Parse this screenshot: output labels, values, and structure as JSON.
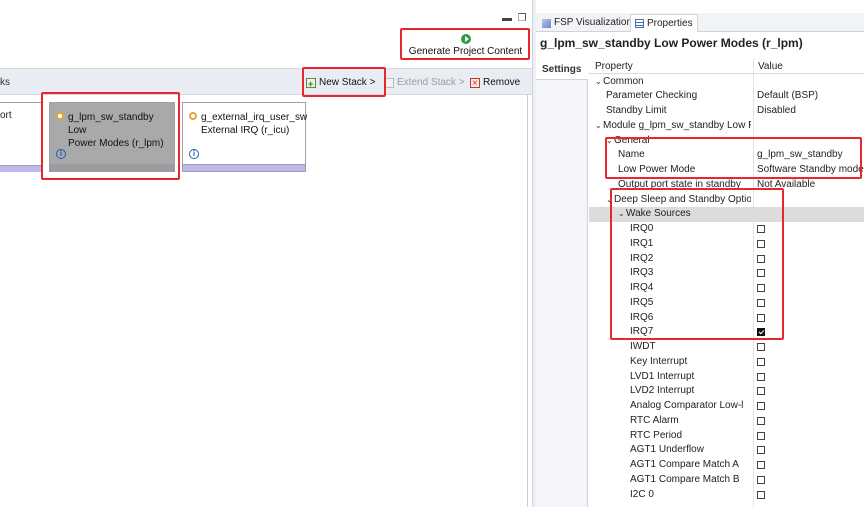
{
  "editor": {
    "generate_label": "Generate Project Content",
    "stacks_title": "ks",
    "toolbar": {
      "new_stack": "New Stack >",
      "extend_stack": "Extend Stack >",
      "remove": "Remove"
    },
    "partial_stack_text": "ort",
    "stacks": [
      {
        "line1": "g_lpm_sw_standby Low",
        "line2": "Power Modes (r_lpm)",
        "selected": true
      },
      {
        "line1": "g_external_irq_user_sw",
        "line2": "External IRQ (r_icu)",
        "selected": false
      }
    ],
    "window_controls": {
      "minimize": "▬",
      "maximize": "❐"
    }
  },
  "properties": {
    "tabs": [
      {
        "label": "FSP Visualization",
        "icon": "fsp-visualization-icon"
      },
      {
        "label": "Properties",
        "icon": "properties-icon",
        "active": true
      }
    ],
    "title": "g_lpm_sw_standby Low Power Modes (r_lpm)",
    "settings_tab": "Settings",
    "columns": {
      "property": "Property",
      "value": "Value"
    },
    "rows": [
      {
        "label": "Common",
        "indent": 0,
        "expander": "down"
      },
      {
        "label": "Parameter Checking",
        "value": "Default (BSP)",
        "indent": 1
      },
      {
        "label": "Standby Limit",
        "value": "Disabled",
        "indent": 1
      },
      {
        "label": "Module g_lpm_sw_standby Low Pc",
        "indent": 0,
        "expander": "down"
      },
      {
        "label": "General",
        "indent": 1,
        "expander": "down"
      },
      {
        "label": "Name",
        "value": "g_lpm_sw_standby",
        "indent": 2
      },
      {
        "label": "Low Power Mode",
        "value": "Software Standby mode",
        "indent": 2
      },
      {
        "label": "Output port state in standby",
        "value": "Not Available",
        "indent": 2
      },
      {
        "label": "Deep Sleep and Standby Optio",
        "indent": 1,
        "expander": "down"
      },
      {
        "label": "Wake Sources",
        "indent": 2,
        "expander": "down",
        "selected": true
      },
      {
        "label": "IRQ0",
        "checkbox": false,
        "indent": 3
      },
      {
        "label": "IRQ1",
        "checkbox": false,
        "indent": 3
      },
      {
        "label": "IRQ2",
        "checkbox": false,
        "indent": 3
      },
      {
        "label": "IRQ3",
        "checkbox": false,
        "indent": 3
      },
      {
        "label": "IRQ4",
        "checkbox": false,
        "indent": 3
      },
      {
        "label": "IRQ5",
        "checkbox": false,
        "indent": 3
      },
      {
        "label": "IRQ6",
        "checkbox": false,
        "indent": 3
      },
      {
        "label": "IRQ7",
        "checkbox": true,
        "indent": 3
      },
      {
        "label": "IWDT",
        "checkbox": false,
        "indent": 3
      },
      {
        "label": "Key Interrupt",
        "checkbox": false,
        "indent": 3
      },
      {
        "label": "LVD1 Interrupt",
        "checkbox": false,
        "indent": 3
      },
      {
        "label": "LVD2 Interrupt",
        "checkbox": false,
        "indent": 3
      },
      {
        "label": "Analog Comparator Low-l",
        "checkbox": false,
        "indent": 3
      },
      {
        "label": "RTC Alarm",
        "checkbox": false,
        "indent": 3
      },
      {
        "label": "RTC Period",
        "checkbox": false,
        "indent": 3
      },
      {
        "label": "AGT1 Underflow",
        "checkbox": false,
        "indent": 3
      },
      {
        "label": "AGT1 Compare Match A",
        "checkbox": false,
        "indent": 3
      },
      {
        "label": "AGT1 Compare Match B",
        "checkbox": false,
        "indent": 3
      },
      {
        "label": "I2C 0",
        "checkbox": false,
        "indent": 3
      }
    ]
  },
  "colors": {
    "highlight": "#e8262e",
    "selected_stack": "#a9a9a9",
    "stack_footer": "#bdb7ec"
  }
}
